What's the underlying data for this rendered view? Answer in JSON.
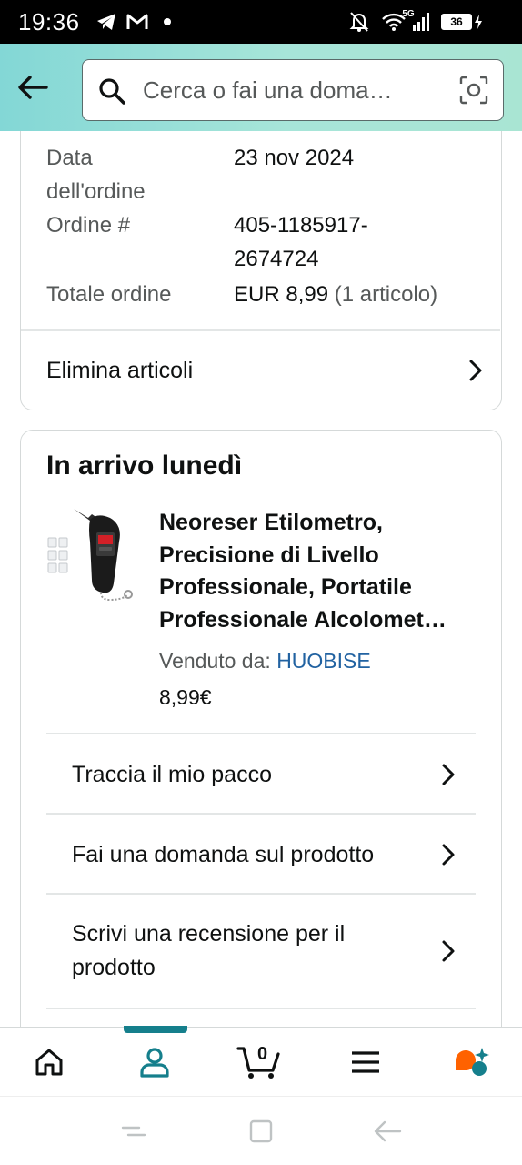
{
  "status_bar": {
    "time": "19:36",
    "network": "5G",
    "battery": "36",
    "icons": [
      "telegram-icon",
      "gmail-icon",
      "dot-icon",
      "mute-icon",
      "wifi-icon",
      "signal-icon",
      "battery-icon"
    ]
  },
  "header": {
    "search_placeholder": "Cerca o fai una doma…",
    "icons": [
      "back-arrow-icon",
      "search-icon",
      "camera-icon"
    ],
    "colors": {
      "gradient_start": "#83d7d6",
      "gradient_end": "#a9e5d3"
    }
  },
  "order_info": {
    "date_label_line1": "Data",
    "date_label_line2": "dell'ordine",
    "date_value": "23 nov 2024",
    "order_label": "Ordine #",
    "order_value_line1": "405-1185917-",
    "order_value_line2": "2674724",
    "total_label": "Totale ordine",
    "total_value": "EUR 8,99",
    "total_items": "(1 articolo)",
    "remove_items": "Elimina articoli"
  },
  "shipment": {
    "title": "In arrivo lunedì",
    "product": {
      "title_line1": "Neoreser Etilometro,",
      "title_line2": "Precisione di Livello",
      "title_line3": "Professionale, Portatile",
      "title_line4": "Professionale Alcolomet…",
      "sold_by_label": "Venduto da:",
      "seller": "HUOBISE",
      "price": "8,99€"
    },
    "actions": [
      {
        "label": "Traccia il mio pacco"
      },
      {
        "label": "Fai una domanda sul prodotto"
      },
      {
        "label_line1": "Scrivi una recensione per il",
        "label_line2": "prodotto"
      }
    ]
  },
  "bottom_nav": {
    "items": [
      "home-icon",
      "account-icon",
      "cart-icon",
      "menu-icon",
      "rufus-icon"
    ],
    "active": "account-icon",
    "cart_count": "0",
    "colors": {
      "active": "#157f8c",
      "rufus": "#ff6200"
    }
  },
  "system_nav": [
    "recents-icon",
    "home-square-icon",
    "back-icon"
  ]
}
